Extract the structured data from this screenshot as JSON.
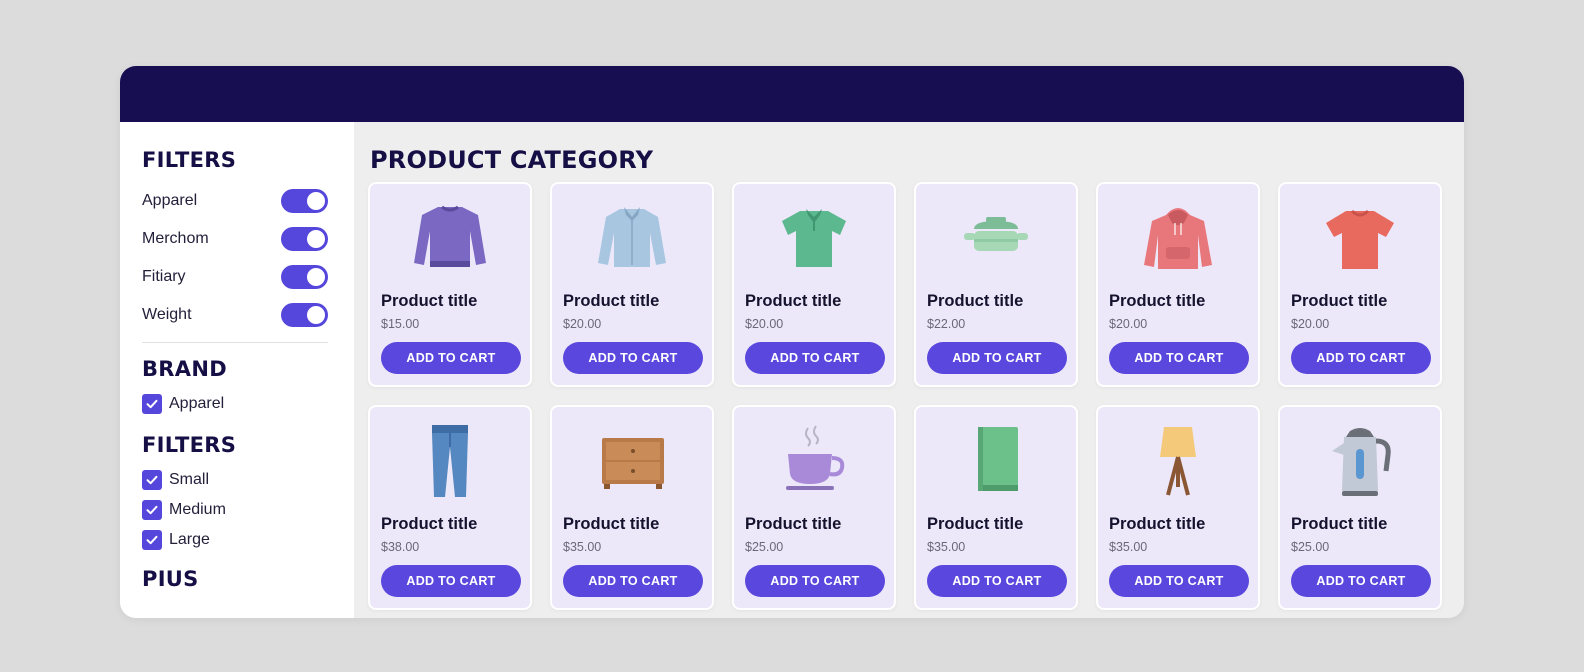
{
  "colors": {
    "header": "#170e52",
    "accent": "#5647dc",
    "card_bg": "#ece8fa",
    "page_bg": "#eeeeee"
  },
  "sidebar": {
    "filters_heading": "FILTERS",
    "toggles": [
      {
        "label": "Apparel",
        "on": true
      },
      {
        "label": "Merchom",
        "on": true
      },
      {
        "label": "Fitiary",
        "on": true
      },
      {
        "label": "Weight",
        "on": true
      }
    ],
    "brand_heading": "BRAND",
    "brand_options": [
      {
        "label": "Apparel",
        "checked": true
      }
    ],
    "filters2_heading": "FILTERS",
    "size_options": [
      {
        "label": "Small",
        "checked": true
      },
      {
        "label": "Medium",
        "checked": true
      },
      {
        "label": "Large",
        "checked": true
      }
    ],
    "pills_heading": "PIUS"
  },
  "main": {
    "title": "PRODUCT CATEGORY",
    "products": [
      {
        "icon": "sweater-icon",
        "title": "Product title",
        "price": "$15.00",
        "button": "ADD TO CART"
      },
      {
        "icon": "dress-shirt-icon",
        "title": "Product title",
        "price": "$20.00",
        "button": "ADD TO CART"
      },
      {
        "icon": "polo-shirt-icon",
        "title": "Product title",
        "price": "$20.00",
        "button": "ADD TO CART"
      },
      {
        "icon": "cooking-pot-icon",
        "title": "Product title",
        "price": "$22.00",
        "button": "ADD TO CART"
      },
      {
        "icon": "hoodie-icon",
        "title": "Product title",
        "price": "$20.00",
        "button": "ADD TO CART"
      },
      {
        "icon": "tshirt-icon",
        "title": "Product title",
        "price": "$20.00",
        "button": "ADD TO CART"
      },
      {
        "icon": "jeans-icon",
        "title": "Product title",
        "price": "$38.00",
        "button": "ADD TO CART"
      },
      {
        "icon": "dresser-icon",
        "title": "Product title",
        "price": "$35.00",
        "button": "ADD TO CART"
      },
      {
        "icon": "coffee-cup-icon",
        "title": "Product title",
        "price": "$25.00",
        "button": "ADD TO CART"
      },
      {
        "icon": "book-icon",
        "title": "Product title",
        "price": "$35.00",
        "button": "ADD TO CART"
      },
      {
        "icon": "lamp-icon",
        "title": "Product title",
        "price": "$35.00",
        "button": "ADD TO CART"
      },
      {
        "icon": "kettle-icon",
        "title": "Product title",
        "price": "$25.00",
        "button": "ADD TO CART"
      }
    ]
  }
}
